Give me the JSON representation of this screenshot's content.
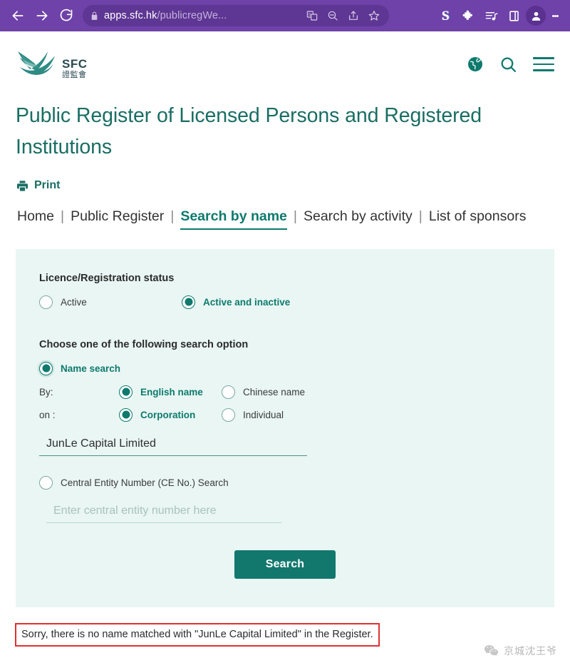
{
  "browser": {
    "back_label": "Back",
    "forward_label": "Forward",
    "reload_label": "Reload",
    "url_domain": "apps.sfc.hk",
    "url_path": "/publicregWe...",
    "lock_icon": "lock-icon",
    "translate_icon": "translate-icon",
    "zoom_icon": "zoom-out-icon",
    "share_icon": "share-icon",
    "bookmark_icon": "star-icon",
    "extensions": [
      {
        "name": "s-extension-icon",
        "label": "S"
      },
      {
        "name": "puzzle-icon",
        "label": "Extensions"
      },
      {
        "name": "media-playlist-icon",
        "label": "Media"
      },
      {
        "name": "side-panel-icon",
        "label": "Side panel"
      }
    ],
    "profile_icon": "profile-avatar-icon",
    "menu_icon": "chrome-menu-icon",
    "chrome_purple": "#6e42a8",
    "omnibox_purple": "#5e3693"
  },
  "site": {
    "logo_abbr": "SFC",
    "logo_chinese": "證監會",
    "logo_icon": "sfc-eagle-logo",
    "language_icon": "globe-icon",
    "search_icon": "search-icon",
    "menu_icon": "hamburger-menu-icon",
    "brand_teal": "#0d7a6d"
  },
  "page": {
    "title": "Public Register of Licensed Persons and Registered Institutions",
    "print_label": "Print",
    "print_icon": "printer-icon"
  },
  "tabs": [
    {
      "label": "Home",
      "active": false
    },
    {
      "label": "Public Register",
      "active": false
    },
    {
      "label": "Search by name",
      "active": true
    },
    {
      "label": "Search by activity",
      "active": false
    },
    {
      "label": "List of sponsors",
      "active": false
    }
  ],
  "tab_separator": "|",
  "form": {
    "status_legend": "Licence/Registration status",
    "status_options": [
      {
        "label": "Active",
        "selected": false
      },
      {
        "label": "Active and inactive",
        "selected": true
      }
    ],
    "option_legend": "Choose one of the following search option",
    "name_search": {
      "label": "Name search",
      "selected": true
    },
    "by_label": "By:",
    "by_options": [
      {
        "label": "English name",
        "selected": true
      },
      {
        "label": "Chinese name",
        "selected": false
      }
    ],
    "on_label": "on :",
    "on_options": [
      {
        "label": "Corporation",
        "selected": true
      },
      {
        "label": "Individual",
        "selected": false
      }
    ],
    "name_input_value": "JunLe Capital Limited",
    "name_input_placeholder": "",
    "ce_search": {
      "label": "Central Entity Number (CE No.) Search",
      "selected": false
    },
    "ce_input_value": "",
    "ce_input_placeholder": "Enter central entity number here",
    "search_button": "Search",
    "panel_bg": "#e9f6f3",
    "button_bg": "#12786e"
  },
  "result": {
    "error_message": "Sorry, there is no name matched with \"JunLe Capital Limited\" in the Register.",
    "annotation_color": "#e03030"
  },
  "watermark": {
    "text": "京城沈王爷",
    "icon": "wechat-icon"
  }
}
